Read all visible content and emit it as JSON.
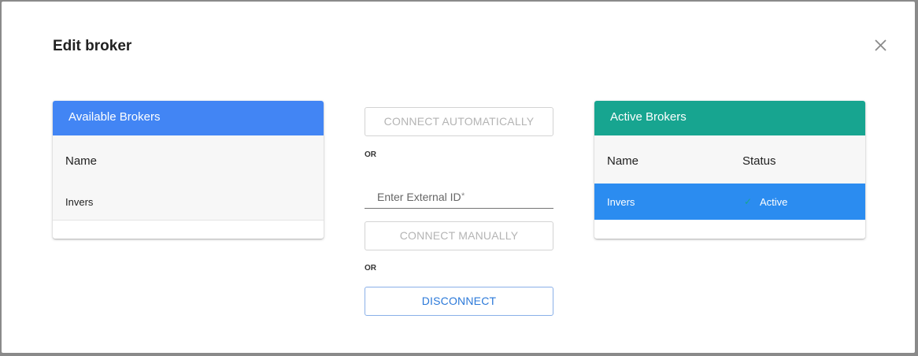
{
  "dialog": {
    "title": "Edit broker",
    "close_icon": "close-icon"
  },
  "available": {
    "header": "Available Brokers",
    "columns": [
      "Name"
    ],
    "rows": [
      {
        "name": "Invers"
      }
    ]
  },
  "actions": {
    "connect_auto": "CONNECT AUTOMATICALLY",
    "or_1": "OR",
    "external_id_placeholder": "Enter External ID",
    "required_mark": "*",
    "connect_manual": "CONNECT MANUALLY",
    "or_2": "OR",
    "disconnect": "DISCONNECT"
  },
  "active": {
    "header": "Active Brokers",
    "columns": [
      "Name",
      "Status"
    ],
    "rows": [
      {
        "name": "Invers",
        "status": "Active",
        "status_icon": "check-icon"
      }
    ]
  },
  "colors": {
    "available_header": "#4285f4",
    "active_header": "#17a590",
    "selected_row": "#2b8cf0",
    "primary_text": "#2b79d9"
  }
}
